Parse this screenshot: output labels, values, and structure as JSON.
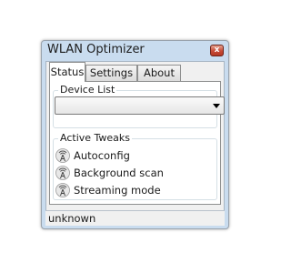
{
  "window": {
    "title": "WLAN Optimizer",
    "close_label": "x"
  },
  "tabs": [
    {
      "label": "Status",
      "active": true
    },
    {
      "label": "Settings",
      "active": false
    },
    {
      "label": "About",
      "active": false
    }
  ],
  "status_tab": {
    "device_list": {
      "label": "Device List",
      "selected_value": ""
    },
    "active_tweaks": {
      "label": "Active Tweaks",
      "items": [
        {
          "label": "Autoconfig",
          "icon": "radio-tower-icon"
        },
        {
          "label": "Background scan",
          "icon": "radio-tower-icon"
        },
        {
          "label": "Streaming mode",
          "icon": "radio-tower-icon"
        }
      ]
    }
  },
  "statusbar": {
    "text": "unknown"
  },
  "colors": {
    "window_frame": "#c9dcef",
    "close_button": "#c74a36",
    "tab_border": "#8e8f8f"
  }
}
